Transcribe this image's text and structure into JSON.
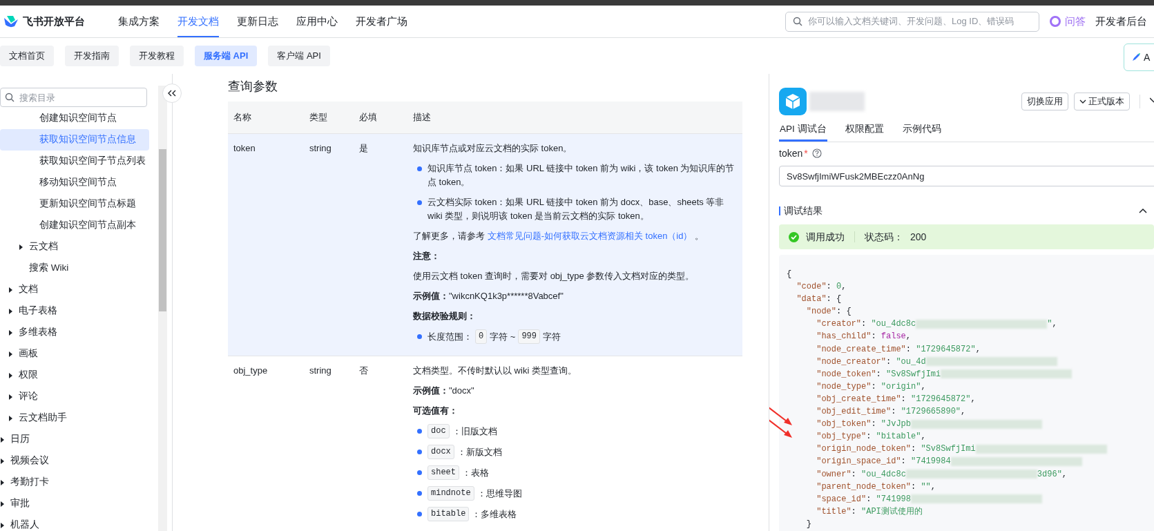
{
  "header": {
    "brand": "飞书开放平台",
    "nav": [
      {
        "label": "集成方案",
        "selected": false
      },
      {
        "label": "开发文档",
        "selected": true
      },
      {
        "label": "更新日志",
        "selected": false
      },
      {
        "label": "应用中心",
        "selected": false
      },
      {
        "label": "开发者广场",
        "selected": false
      }
    ],
    "search": {
      "placeholder": "你可以输入文档关键词、开发问题、Log ID、错误码"
    },
    "ask": "问答",
    "console": "开发者后台"
  },
  "subnav": [
    {
      "label": "文档首页",
      "selected": false
    },
    {
      "label": "开发指南",
      "selected": false
    },
    {
      "label": "开发教程",
      "selected": false
    },
    {
      "label": "服务端 API",
      "selected": true
    },
    {
      "label": "客户端 API",
      "selected": false
    }
  ],
  "side_button": {
    "label": "A"
  },
  "sidebar": {
    "search": {
      "placeholder": "搜索目录"
    },
    "tree": [
      {
        "children": [
          {
            "children": [
              {
                "children": [
                  {
                    "label": "创建知识空间节点",
                    "selected": false
                  },
                  {
                    "label": "获取知识空间节点信息",
                    "selected": true
                  },
                  {
                    "label": "获取知识空间子节点列表",
                    "selected": false
                  },
                  {
                    "label": "移动知识空间节点",
                    "selected": false
                  },
                  {
                    "label": "更新知识空间节点标题",
                    "selected": false
                  },
                  {
                    "label": "创建知识空间节点副本",
                    "selected": false
                  }
                ]
              },
              {
                "label": "云文档",
                "selected": false,
                "expanded": false
              },
              {
                "label": "搜索 Wiki",
                "selected": false
              }
            ]
          },
          {
            "label": "文档",
            "selected": false,
            "expanded": false
          },
          {
            "label": "电子表格",
            "selected": false,
            "expanded": false
          },
          {
            "label": "多维表格",
            "selected": false,
            "expanded": false
          },
          {
            "label": "画板",
            "selected": false,
            "expanded": false
          },
          {
            "label": "权限",
            "selected": false,
            "expanded": false
          },
          {
            "label": "评论",
            "selected": false,
            "expanded": false
          },
          {
            "label": "云文档助手",
            "selected": false,
            "expanded": false
          }
        ]
      },
      {
        "label": "日历",
        "selected": false,
        "expanded": false
      },
      {
        "label": "视频会议",
        "selected": false,
        "expanded": false
      },
      {
        "label": "考勤打卡",
        "selected": false,
        "expanded": false
      },
      {
        "label": "审批",
        "selected": false,
        "expanded": false
      },
      {
        "label": "机器人",
        "selected": false,
        "expanded": false
      }
    ]
  },
  "params": {
    "title": "查询参数",
    "columns": [
      "名称",
      "类型",
      "必填",
      "描述"
    ],
    "rows": [
      {
        "name": "token",
        "type": "string",
        "required": "是",
        "highlighted": true,
        "description": [
          {
            "kind": "paragraph",
            "parts": [
              {
                "kind": "text",
                "text": "知识库节点或对应云文档的实际 token。"
              }
            ]
          },
          {
            "kind": "bullet",
            "parts": [
              {
                "kind": "text",
                "text": "知识库节点 token：如果 URL 链接中 token 前为 wiki，该 token 为知识库的节点 token。"
              }
            ]
          },
          {
            "kind": "bullet",
            "parts": [
              {
                "kind": "text",
                "text": "云文档实际 token：如果 URL 链接中 token 前为 docx、base、sheets 等非 wiki 类型，则说明该 token 是当前云文档的实际 token。"
              }
            ]
          },
          {
            "kind": "paragraph",
            "parts": [
              {
                "kind": "text",
                "text": "了解更多，请参考 "
              },
              {
                "kind": "link",
                "text": "文档常见问题-如何获取云文档资源相关 token（id）"
              },
              {
                "kind": "text",
                "text": " 。"
              }
            ]
          },
          {
            "kind": "paragraph",
            "parts": [
              {
                "kind": "bold",
                "text": "注意："
              }
            ]
          },
          {
            "kind": "paragraph",
            "parts": [
              {
                "kind": "text",
                "text": "使用云文档 token 查询时，需要对 obj_type 参数传入文档对应的类型。"
              }
            ]
          },
          {
            "kind": "paragraph",
            "parts": [
              {
                "kind": "bold",
                "text": "示例值："
              },
              {
                "kind": "text",
                "text": "\"wikcnKQ1k3p******8Vabcef\""
              }
            ]
          },
          {
            "kind": "paragraph",
            "parts": [
              {
                "kind": "bold",
                "text": "数据校验规则："
              }
            ]
          },
          {
            "kind": "bullet",
            "parts": [
              {
                "kind": "text",
                "text": "长度范围："
              },
              {
                "kind": "code",
                "text": "0"
              },
              {
                "kind": "text",
                "text": "字符 ~"
              },
              {
                "kind": "code",
                "text": "999"
              },
              {
                "kind": "text",
                "text": "字符"
              }
            ]
          }
        ]
      },
      {
        "name": "obj_type",
        "type": "string",
        "required": "否",
        "highlighted": false,
        "description": [
          {
            "kind": "paragraph",
            "parts": [
              {
                "kind": "text",
                "text": "文档类型。不传时默认以 wiki 类型查询。"
              }
            ]
          },
          {
            "kind": "paragraph",
            "parts": [
              {
                "kind": "bold",
                "text": "示例值："
              },
              {
                "kind": "text",
                "text": "\"docx\""
              }
            ]
          },
          {
            "kind": "paragraph",
            "parts": [
              {
                "kind": "bold",
                "text": "可选值有："
              }
            ]
          },
          {
            "kind": "bullet",
            "parts": [
              {
                "kind": "code",
                "text": "doc"
              },
              {
                "kind": "text",
                "text": "：旧版文档"
              }
            ]
          },
          {
            "kind": "bullet",
            "parts": [
              {
                "kind": "code",
                "text": "docx"
              },
              {
                "kind": "text",
                "text": "：新版文档"
              }
            ]
          },
          {
            "kind": "bullet",
            "parts": [
              {
                "kind": "code",
                "text": "sheet"
              },
              {
                "kind": "text",
                "text": "：表格"
              }
            ]
          },
          {
            "kind": "bullet",
            "parts": [
              {
                "kind": "code",
                "text": "mindnote"
              },
              {
                "kind": "text",
                "text": "：思维导图"
              }
            ]
          },
          {
            "kind": "bullet",
            "parts": [
              {
                "kind": "code",
                "text": "bitable"
              },
              {
                "kind": "text",
                "text": "：多维表格"
              }
            ]
          }
        ]
      }
    ]
  },
  "panel": {
    "buttons": [
      {
        "label": "切换应用",
        "kind": "plain"
      },
      {
        "label": "正式版本",
        "kind": "dropdown"
      }
    ],
    "tabs": [
      {
        "label": "API 调试台",
        "selected": true
      },
      {
        "label": "权限配置",
        "selected": false
      },
      {
        "label": "示例代码",
        "selected": false
      }
    ],
    "field": {
      "label": "token",
      "required_mark": "*",
      "value": "Sv8SwfjImiWFusk2MBEczz0AnNg"
    },
    "result": {
      "title": "调试结果",
      "status": "调用成功",
      "code_label": "状态码：",
      "code": "200"
    },
    "code": [
      [
        {
          "kind": "plain",
          "text": "{"
        }
      ],
      [
        {
          "kind": "key",
          "text": "\"code\""
        },
        {
          "kind": "plain",
          "text": ": "
        },
        {
          "kind": "number",
          "text": "0"
        },
        {
          "kind": "plain",
          "text": ","
        }
      ],
      [
        {
          "kind": "key",
          "text": "\"data\""
        },
        {
          "kind": "plain",
          "text": ": {"
        }
      ],
      [
        {
          "kind": "key",
          "text": "\"node\""
        },
        {
          "kind": "plain",
          "text": ": {"
        }
      ],
      [
        {
          "kind": "key",
          "text": "\"creator\""
        },
        {
          "kind": "plain",
          "text": ": "
        },
        {
          "kind": "string",
          "text": "\"ou_4dc8c"
        },
        {
          "kind": "blur"
        },
        {
          "kind": "string",
          "text": "\""
        },
        {
          "kind": "plain",
          "text": ","
        }
      ],
      [
        {
          "kind": "key",
          "text": "\"has_child\""
        },
        {
          "kind": "plain",
          "text": ": "
        },
        {
          "kind": "bool",
          "text": "false"
        },
        {
          "kind": "plain",
          "text": ","
        }
      ],
      [
        {
          "kind": "key",
          "text": "\"node_create_time\""
        },
        {
          "kind": "plain",
          "text": ": "
        },
        {
          "kind": "string",
          "text": "\"1729645872\""
        },
        {
          "kind": "plain",
          "text": ","
        }
      ],
      [
        {
          "kind": "key",
          "text": "\"node_creator\""
        },
        {
          "kind": "plain",
          "text": ": "
        },
        {
          "kind": "string",
          "text": "\"ou_4d"
        },
        {
          "kind": "blur"
        }
      ],
      [
        {
          "kind": "key",
          "text": "\"node_token\""
        },
        {
          "kind": "plain",
          "text": ": "
        },
        {
          "kind": "string",
          "text": "\"Sv8SwfjImi"
        },
        {
          "kind": "blur"
        }
      ],
      [
        {
          "kind": "key",
          "text": "\"node_type\""
        },
        {
          "kind": "plain",
          "text": ": "
        },
        {
          "kind": "string",
          "text": "\"origin\""
        },
        {
          "kind": "plain",
          "text": ","
        }
      ],
      [
        {
          "kind": "key",
          "text": "\"obj_create_time\""
        },
        {
          "kind": "plain",
          "text": ": "
        },
        {
          "kind": "string",
          "text": "\"1729645872\""
        },
        {
          "kind": "plain",
          "text": ","
        }
      ],
      [
        {
          "kind": "key",
          "text": "\"obj_edit_time\""
        },
        {
          "kind": "plain",
          "text": ": "
        },
        {
          "kind": "string",
          "text": "\"1729665890\""
        },
        {
          "kind": "plain",
          "text": ","
        }
      ],
      [
        {
          "kind": "arrow"
        },
        {
          "kind": "key",
          "text": "\"obj_token\""
        },
        {
          "kind": "plain",
          "text": ": "
        },
        {
          "kind": "string",
          "text": "\"JvJpb"
        },
        {
          "kind": "blur"
        }
      ],
      [
        {
          "kind": "arrow"
        },
        {
          "kind": "key",
          "text": "\"obj_type\""
        },
        {
          "kind": "plain",
          "text": ": "
        },
        {
          "kind": "string",
          "text": "\"bitable\""
        },
        {
          "kind": "plain",
          "text": ","
        }
      ],
      [
        {
          "kind": "key",
          "text": "\"origin_node_token\""
        },
        {
          "kind": "plain",
          "text": ": "
        },
        {
          "kind": "string",
          "text": "\"Sv8SwfjImi"
        },
        {
          "kind": "blur"
        }
      ],
      [
        {
          "kind": "key",
          "text": "\"origin_space_id\""
        },
        {
          "kind": "plain",
          "text": ": "
        },
        {
          "kind": "string",
          "text": "\"7419984"
        },
        {
          "kind": "blur"
        }
      ],
      [
        {
          "kind": "key",
          "text": "\"owner\""
        },
        {
          "kind": "plain",
          "text": ": "
        },
        {
          "kind": "string",
          "text": "\"ou_4dc8c"
        },
        {
          "kind": "blur"
        },
        {
          "kind": "string",
          "text": "3d96\""
        },
        {
          "kind": "plain",
          "text": ","
        }
      ],
      [
        {
          "kind": "key",
          "text": "\"parent_node_token\""
        },
        {
          "kind": "plain",
          "text": ": "
        },
        {
          "kind": "string",
          "text": "\"\""
        },
        {
          "kind": "plain",
          "text": ","
        }
      ],
      [
        {
          "kind": "key",
          "text": "\"space_id\""
        },
        {
          "kind": "plain",
          "text": ": "
        },
        {
          "kind": "string",
          "text": "\"741998"
        },
        {
          "kind": "blur"
        }
      ],
      [
        {
          "kind": "key",
          "text": "\"title\""
        },
        {
          "kind": "plain",
          "text": ": "
        },
        {
          "kind": "string",
          "text": "\"API测试使用的"
        }
      ],
      [
        {
          "kind": "plain",
          "text": "}"
        }
      ]
    ]
  }
}
